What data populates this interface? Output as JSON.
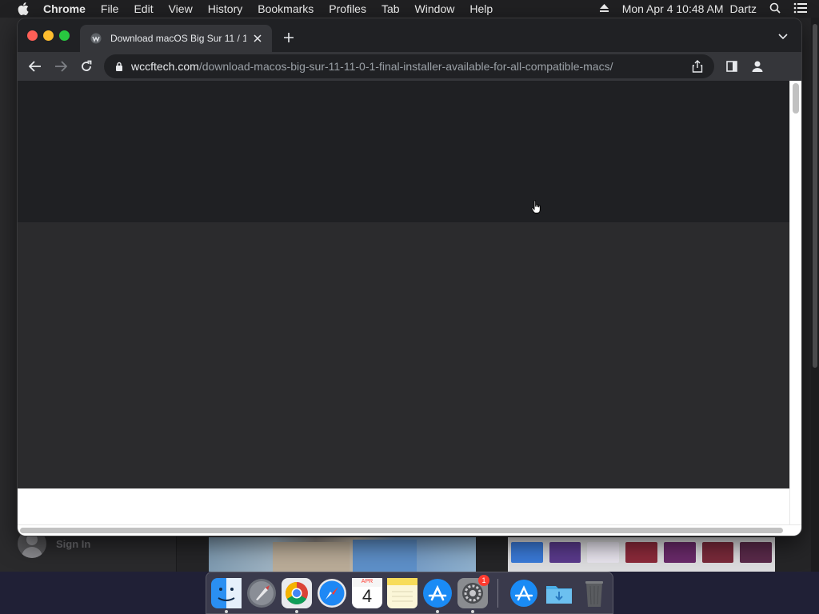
{
  "menubar": {
    "app_name": "Chrome",
    "items": [
      "File",
      "Edit",
      "View",
      "History",
      "Bookmarks",
      "Profiles",
      "Tab",
      "Window",
      "Help"
    ],
    "clock": "Mon Apr 4  10:48 AM",
    "user": "Dartz"
  },
  "background_app": {
    "signin_label": "Sign In"
  },
  "chrome": {
    "tab_title": "Download macOS Big Sur 11 / 1",
    "url_host": "wccftech.com",
    "url_path": "/download-macos-big-sur-11-11-0-1-final-installer-available-for-all-compatible-macs/"
  },
  "dock": {
    "items": [
      {
        "name": "finder-icon",
        "color": "#2a8ff2",
        "running": true
      },
      {
        "name": "launchpad-icon",
        "color": "#6b6f78",
        "running": false
      },
      {
        "name": "chrome-icon",
        "color": "#e9ebee",
        "running": true
      },
      {
        "name": "safari-icon",
        "color": "#1e88f5",
        "running": false
      },
      {
        "name": "calendar-icon",
        "color": "#ffffff",
        "running": false,
        "month": "APR",
        "day": "4"
      },
      {
        "name": "notes-icon",
        "color": "#f7dc5a",
        "running": false
      },
      {
        "name": "app-store-icon",
        "color": "#1a8bf5",
        "running": true
      },
      {
        "name": "system-preferences-icon",
        "color": "#8a8c90",
        "running": true,
        "badge": "1"
      }
    ],
    "right_items": [
      {
        "name": "app-store-folder-icon",
        "color": "#1a8bf5"
      },
      {
        "name": "downloads-folder-icon",
        "color": "#4aaee8"
      },
      {
        "name": "trash-icon",
        "color": "#5a5c60"
      }
    ]
  }
}
